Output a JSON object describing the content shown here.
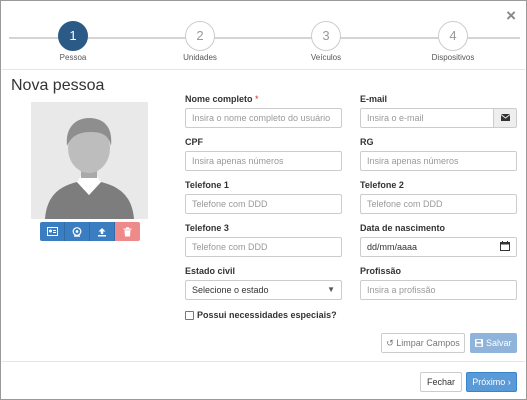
{
  "stepper": {
    "steps": [
      {
        "number": "1",
        "label": "Pessoa"
      },
      {
        "number": "2",
        "label": "Unidades"
      },
      {
        "number": "3",
        "label": "Veículos"
      },
      {
        "number": "4",
        "label": "Dispositivos"
      }
    ],
    "active_step": 1
  },
  "close_glyph": "×",
  "page_title": "Nova pessoa",
  "photo_actions": [
    {
      "icon": "id-card-icon"
    },
    {
      "icon": "webcam-icon"
    },
    {
      "icon": "upload-icon"
    },
    {
      "icon": "trash-icon"
    }
  ],
  "form": {
    "nome": {
      "label": "Nome completo",
      "required_mark": "*",
      "placeholder": "Insira o nome completo do usuário"
    },
    "email": {
      "label": "E-mail",
      "placeholder": "Insira o e-mail",
      "addon_icon": "envelope-icon"
    },
    "cpf": {
      "label": "CPF",
      "placeholder": "Insira apenas números"
    },
    "rg": {
      "label": "RG",
      "placeholder": "Insira apenas números"
    },
    "telefone1": {
      "label": "Telefone 1",
      "placeholder": "Telefone com DDD"
    },
    "telefone2": {
      "label": "Telefone 2",
      "placeholder": "Telefone com DDD"
    },
    "telefone3": {
      "label": "Telefone 3",
      "placeholder": "Telefone com DDD"
    },
    "nascimento": {
      "label": "Data de nascimento",
      "placeholder": "dd/mm/aaaa"
    },
    "estado_civil": {
      "label": "Estado civil",
      "selected": "Selecione o estado"
    },
    "profissao": {
      "label": "Profissão",
      "placeholder": "Insira a profissão"
    },
    "necessidades": {
      "label": "Possui necessidades especiais?",
      "checked": false
    }
  },
  "buttons": {
    "clear": "Limpar Campos",
    "save": "Salvar",
    "close": "Fechar",
    "next": "Próximo"
  },
  "colors": {
    "primary": "#2b5a87",
    "button_blue": "#5b9ad8",
    "save_disabled": "#8fb3d9",
    "delete": "#ee8a8a",
    "required": "#c9302c"
  }
}
